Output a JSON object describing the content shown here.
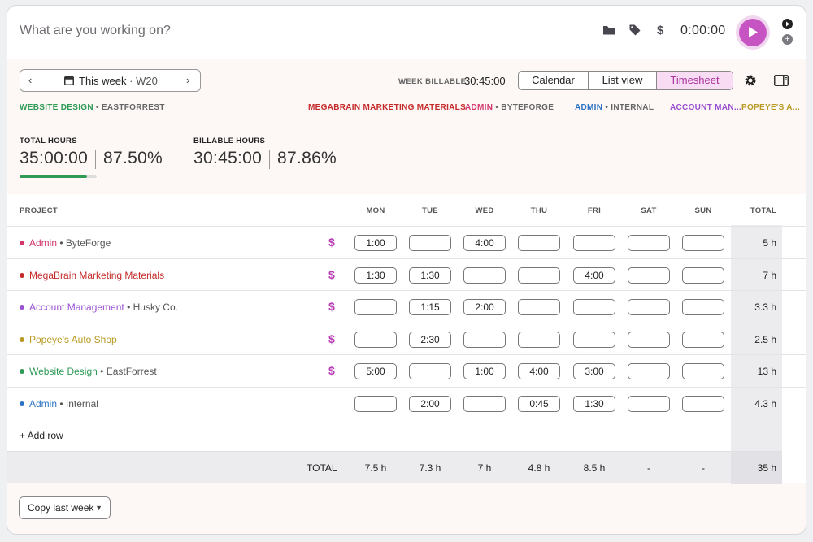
{
  "topbar": {
    "task_placeholder": "What are you working on?",
    "timer": "0:00:00",
    "icons": [
      "folder-icon",
      "tag-icon",
      "dollar-icon",
      "play-icon"
    ]
  },
  "controls": {
    "week_label": "This week",
    "week_sep": "·",
    "week_number": "W20",
    "week_billable_label": "WEEK BILLABLE",
    "week_billable_value": "30:45:00",
    "views": [
      "Calendar",
      "List view",
      "Timesheet"
    ],
    "active_view": "Timesheet"
  },
  "project_bars": [
    {
      "name": "WEBSITE DESIGN",
      "client": "EASTFORREST",
      "color": "#2f9a55"
    },
    {
      "name": "MEGABRAIN MARKETING MATERIALS",
      "client": "",
      "color": "#c52a2a"
    },
    {
      "name": "ADMIN",
      "client": "BYTEFORGE",
      "color": "#d2376e"
    },
    {
      "name": "ADMIN",
      "client": "INTERNAL",
      "color": "#2b72c4"
    },
    {
      "name": "ACCOUNT MAN...",
      "client": "",
      "color": "#9a4fd0"
    },
    {
      "name": "POPEYE'S A...",
      "client": "",
      "color": "#b89a22"
    }
  ],
  "stats": {
    "total_label": "TOTAL HOURS",
    "total_value": "35:00:00",
    "total_pct": "87.50%",
    "billable_label": "BILLABLE HOURS",
    "billable_value": "30:45:00",
    "billable_pct": "87.86%",
    "progress_fraction": 0.875
  },
  "table": {
    "headers": [
      "PROJECT",
      "MON",
      "TUE",
      "WED",
      "THU",
      "FRI",
      "SAT",
      "SUN",
      "TOTAL"
    ],
    "rows": [
      {
        "project": "Admin",
        "client": "ByteForge",
        "color": "#d2376e",
        "billable": true,
        "days": [
          "1:00",
          "",
          "4:00",
          "",
          "",
          "",
          ""
        ],
        "total": "5 h"
      },
      {
        "project": "MegaBrain Marketing Materials",
        "client": "",
        "color": "#c52a2a",
        "billable": true,
        "days": [
          "1:30",
          "1:30",
          "",
          "",
          "4:00",
          "",
          ""
        ],
        "total": "7 h"
      },
      {
        "project": "Account Management",
        "client": "Husky Co.",
        "color": "#9a4fd0",
        "billable": true,
        "days": [
          "",
          "1:15",
          "2:00",
          "",
          "",
          "",
          ""
        ],
        "total": "3.3 h"
      },
      {
        "project": "Popeye's Auto Shop",
        "client": "",
        "color": "#b89a22",
        "billable": true,
        "days": [
          "",
          "2:30",
          "",
          "",
          "",
          "",
          ""
        ],
        "total": "2.5 h"
      },
      {
        "project": "Website Design",
        "client": "EastForrest",
        "color": "#2f9a55",
        "billable": true,
        "days": [
          "5:00",
          "",
          "1:00",
          "4:00",
          "3:00",
          "",
          ""
        ],
        "total": "13 h"
      },
      {
        "project": "Admin",
        "client": "Internal",
        "color": "#2b72c4",
        "billable": false,
        "days": [
          "",
          "2:00",
          "",
          "0:45",
          "1:30",
          "",
          ""
        ],
        "total": "4.3 h"
      }
    ],
    "add_row": "+ Add row",
    "totals_label": "TOTAL",
    "totals": [
      "7.5 h",
      "7.3 h",
      "7 h",
      "4.8 h",
      "8.5 h",
      "-",
      "-",
      "35 h"
    ]
  },
  "footer": {
    "copy_button": "Copy last week"
  }
}
